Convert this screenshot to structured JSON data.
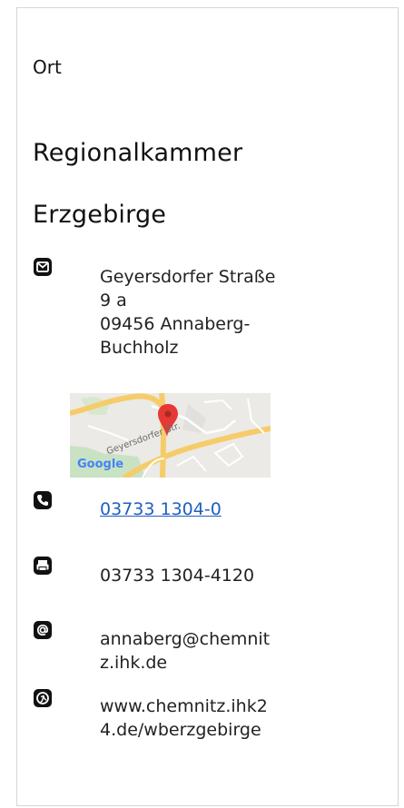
{
  "section": {
    "label": "Ort"
  },
  "chamber": {
    "title_line1": "Regionalkammer",
    "title_line2": "Erzgebirge"
  },
  "address": {
    "icon": "mail-icon",
    "lines": [
      "Geyersdorfer Straße",
      "9 a",
      "09456 Annaberg-",
      "Buchholz"
    ]
  },
  "map": {
    "street_label": "Geyersdorfer Str.",
    "logo_text": "Google",
    "pin_color": "#e53935"
  },
  "phone": {
    "icon": "phone-icon",
    "value": "03733 1304-0"
  },
  "fax": {
    "icon": "fax-icon",
    "value": "03733 1304-4120"
  },
  "email": {
    "icon": "email-icon",
    "lines": [
      "annaberg@chemnit",
      "z.ihk.de"
    ]
  },
  "website": {
    "icon": "web-icon",
    "lines": [
      "www.chemnitz.ihk2",
      "4.de/wberzgebirge"
    ]
  },
  "colors": {
    "link": "#1f5fbf",
    "text": "#222222",
    "border": "#d6d6d6",
    "icon": "#111111"
  }
}
